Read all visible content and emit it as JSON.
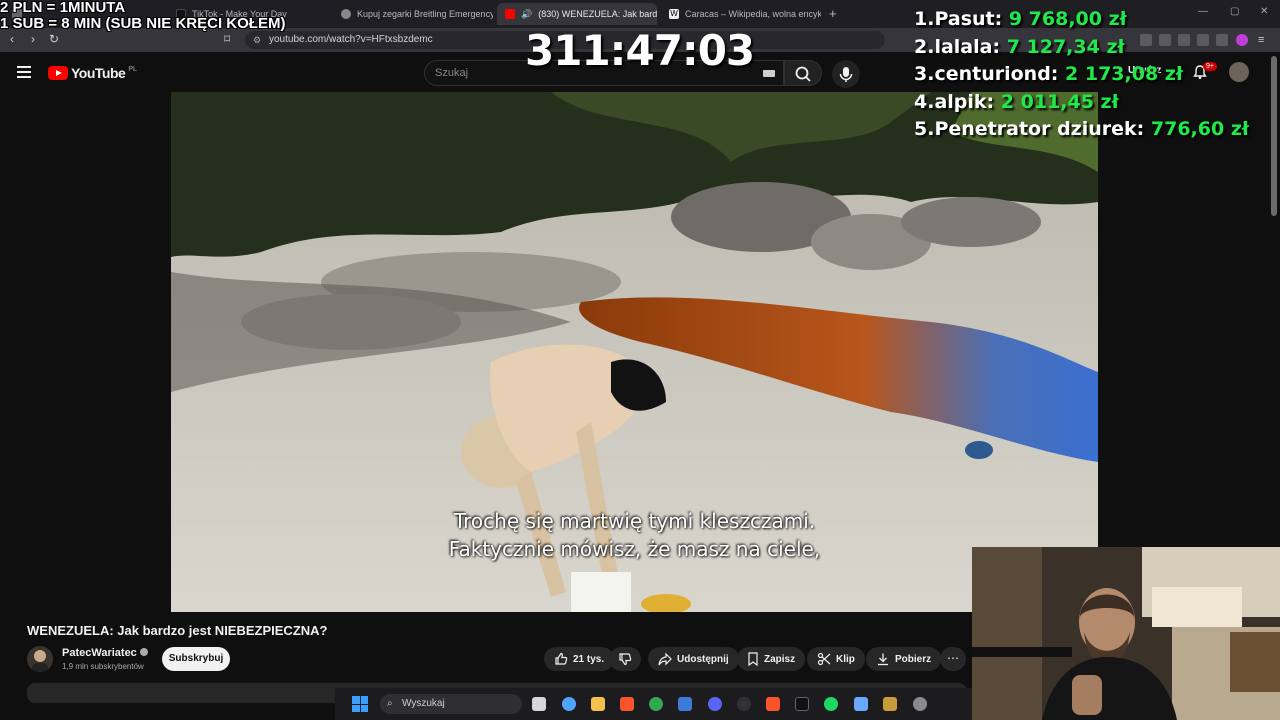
{
  "browser": {
    "tabs": [
      {
        "label": "",
        "active": false
      },
      {
        "label": "TikTok - Make Your Day",
        "active": false
      },
      {
        "label": "Kupuj zegarki Breitling Emergency R",
        "active": false
      },
      {
        "label": "(830) WENEZUELA: Jak bardzo",
        "active": true
      },
      {
        "label": "Caracas – Wikipedia, wolna encyklop",
        "active": false
      }
    ],
    "url": "youtube.com/watch?v=HFtxsbzdemc"
  },
  "overlay": {
    "donation_line1": "2 PLN =  1MINUTA",
    "donation_line2": "1 SUB = 8 MIN (SUB NIE KRĘCI KOŁEM)",
    "timer": "311:47:03",
    "leaderboard": [
      {
        "rank": "1.",
        "name": "Pasut:",
        "amount": "9 768,00 zł"
      },
      {
        "rank": "2.",
        "name": "lalala:",
        "amount": "7 127,34 zł"
      },
      {
        "rank": "3.",
        "name": "centuriond:",
        "amount": "2 173,08 zł"
      },
      {
        "rank": "4.",
        "name": "alpik:",
        "amount": "2 011,45 zł"
      },
      {
        "rank": "5.",
        "name": "Penetrator dziurek:",
        "amount": "776,60 zł"
      }
    ]
  },
  "youtube": {
    "logo": "YouTube",
    "country": "PL",
    "search_placeholder": "Szukaj",
    "create_label": "Utwórz",
    "notifications_badge": "9+",
    "video": {
      "subtitle_line1": "Trochę się martwię tymi kleszczami.",
      "subtitle_line2": "Faktycznie mówisz, że masz na ciele,"
    },
    "title": "WENEZUELA: Jak bardzo jest NIEBEZPIECZNA?",
    "channel": {
      "name": "PatecWariatec",
      "subscribers": "1,9 mln subskrybentów",
      "subscribe_label": "Subskrybuj"
    },
    "actions": {
      "likes": "21 tys.",
      "share": "Udostępnij",
      "save": "Zapisz",
      "clip": "Klip",
      "download": "Pobierz"
    }
  },
  "taskbar": {
    "search_placeholder": "Wyszukaj"
  },
  "colors": {
    "leaderboard_amount": "#20e94a",
    "yt_red": "#ff0000",
    "background": "#0f0f0f"
  }
}
